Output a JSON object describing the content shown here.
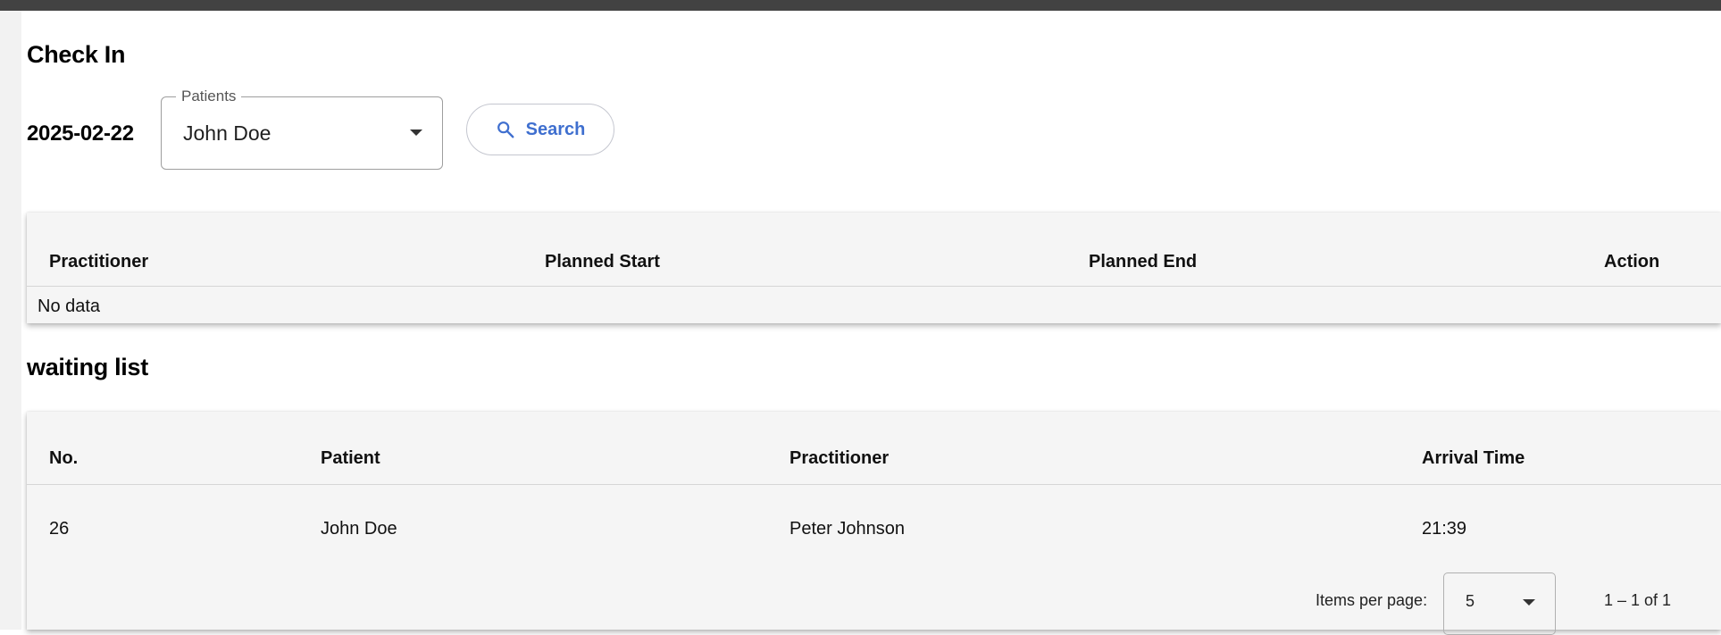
{
  "checkin": {
    "title": "Check In",
    "date": "2025-02-22",
    "patients_field": {
      "label": "Patients",
      "value": "John Doe"
    },
    "search_button": {
      "label": "Search",
      "icon": "search-icon"
    },
    "table": {
      "columns": [
        "Practitioner",
        "Planned Start",
        "Planned End",
        "Action"
      ],
      "empty_text": "No data"
    }
  },
  "waiting": {
    "title": "waiting list",
    "table": {
      "columns": [
        "No.",
        "Patient",
        "Practitioner",
        "Arrival Time"
      ],
      "rows": [
        [
          "26",
          "John Doe",
          "Peter Johnson",
          "21:39"
        ]
      ]
    },
    "paginator": {
      "items_per_page_label": "Items per page:",
      "items_per_page_value": "5",
      "range_label": "1 – 1 of 1"
    }
  },
  "colors": {
    "topbar": "#424242",
    "accent": "#3f6fcf",
    "table_bg": "#f5f5f5"
  }
}
